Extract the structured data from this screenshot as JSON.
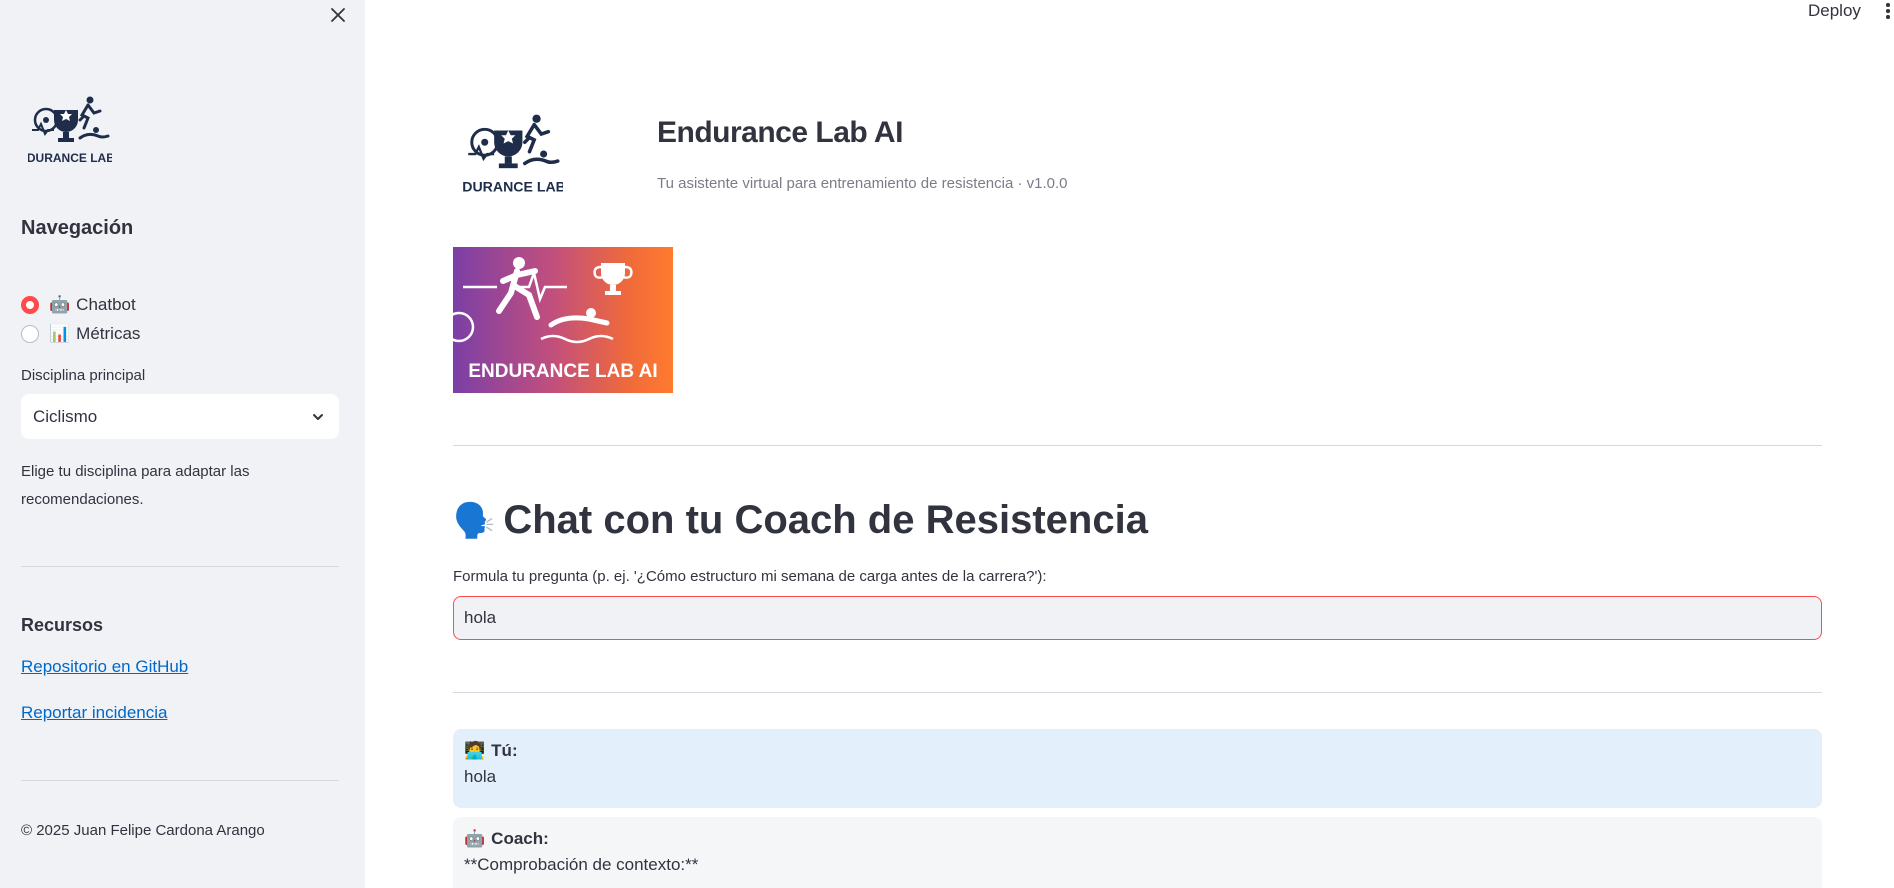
{
  "sidebar": {
    "logo_text": "ENDURANCE LAB AI",
    "nav_heading": "Navegación",
    "nav_options": [
      {
        "icon": "🤖",
        "label": "Chatbot",
        "selected": true
      },
      {
        "icon": "📊",
        "label": "Métricas",
        "selected": false
      }
    ],
    "discipline_label": "Disciplina principal",
    "discipline_value": "Ciclismo",
    "discipline_help": "Elige tu disciplina para adaptar las recomendaciones.",
    "resources_heading": "Recursos",
    "links": [
      "Repositorio en GitHub",
      "Reportar incidencia"
    ],
    "footer": "© 2025 Juan Felipe Cardona Arango"
  },
  "topbar": {
    "deploy_label": "Deploy"
  },
  "header": {
    "logo_text": "ENDURANCE LAB AI",
    "title": "Endurance Lab AI",
    "subtitle": "Tu asistente virtual para entrenamiento de resistencia · v1.0.0"
  },
  "banner": {
    "text": "ENDURANCE LAB AI"
  },
  "chat": {
    "heading_icon": "🗣️",
    "heading": "Chat con tu Coach de Resistencia",
    "input_label": "Formula tu pregunta (p. ej. '¿Cómo estructuro mi semana de carga antes de la carrera?'):",
    "input_value": "hola",
    "messages": [
      {
        "icon": "🧑‍💻",
        "author": "Tú:",
        "text": "hola",
        "role": "user"
      },
      {
        "icon": "🤖",
        "author": "Coach:",
        "text": "**Comprobación de contexto:**",
        "role": "coach"
      }
    ]
  },
  "colors": {
    "accent": "#ff4b4b",
    "link": "#0068c9",
    "sidebar_bg": "#f0f2f6",
    "user_msg_bg": "#e3f0fc",
    "logo_navy": "#1f2d4a"
  }
}
